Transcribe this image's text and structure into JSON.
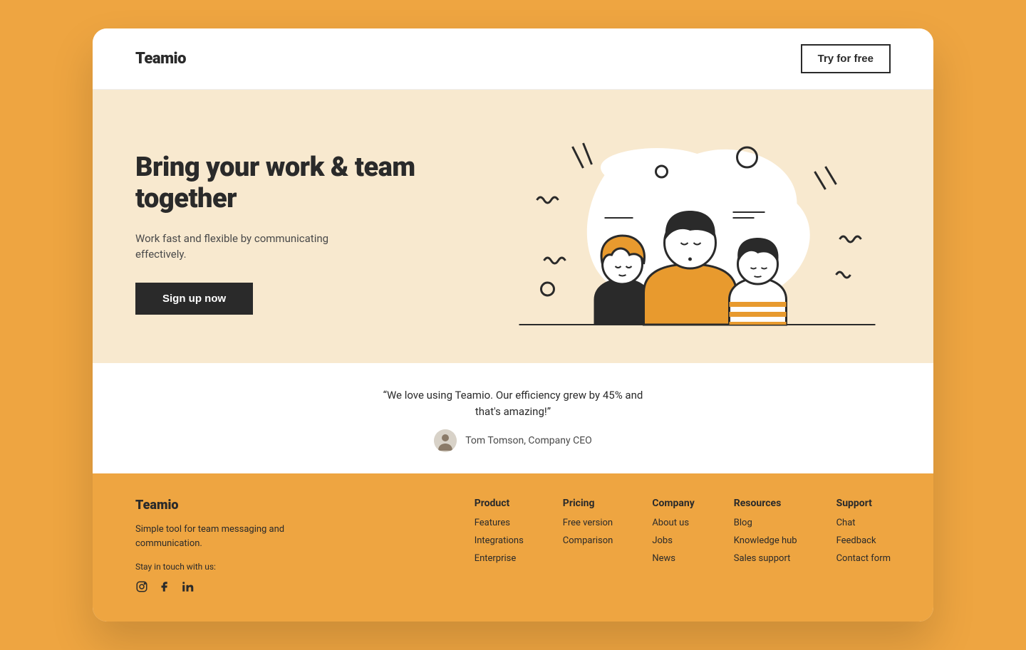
{
  "header": {
    "logo": "Teamio",
    "cta": "Try for free"
  },
  "hero": {
    "title": "Bring your work & team together",
    "subtitle": "Work fast and flexible by communicating effectively.",
    "cta": "Sign up now"
  },
  "quote": {
    "text": "“We love using Teamio. Our efficiency grew by 45% and that's amazing!”",
    "author": "Tom Tomson, Company CEO"
  },
  "footer": {
    "logo": "Teamio",
    "tagline": "Simple tool for team messaging and communication.",
    "stay": "Stay in touch with us:",
    "columns": [
      {
        "title": "Product",
        "links": [
          "Features",
          "Integrations",
          "Enterprise"
        ]
      },
      {
        "title": "Pricing",
        "links": [
          "Free version",
          "Comparison"
        ]
      },
      {
        "title": "Company",
        "links": [
          "About us",
          "Jobs",
          "News"
        ]
      },
      {
        "title": "Resources",
        "links": [
          "Blog",
          "Knowledge hub",
          "Sales support"
        ]
      },
      {
        "title": "Support",
        "links": [
          "Chat",
          "Feedback",
          "Contact form"
        ]
      }
    ]
  }
}
